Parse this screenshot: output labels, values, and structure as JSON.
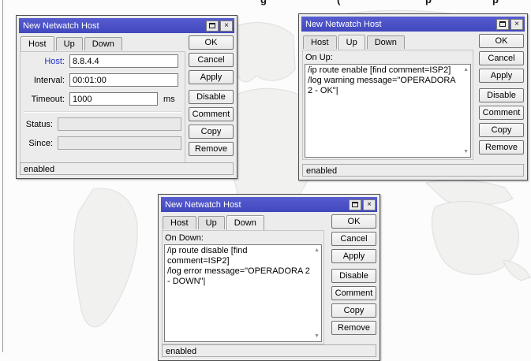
{
  "window": {
    "title": "New Netwatch Host",
    "close_glyph": "×"
  },
  "tabs": {
    "host": "Host",
    "up": "Up",
    "down": "Down"
  },
  "actions": {
    "ok": "OK",
    "cancel": "Cancel",
    "apply": "Apply",
    "disable": "Disable",
    "comment": "Comment",
    "copy": "Copy",
    "remove": "Remove"
  },
  "statusbar": {
    "text": "enabled"
  },
  "host_dialog": {
    "fields": {
      "host": {
        "label": "Host:",
        "value": "8.8.4.4"
      },
      "interval": {
        "label": "Interval:",
        "value": "00:01:00"
      },
      "timeout": {
        "label": "Timeout:",
        "value": "1000",
        "unit": "ms"
      },
      "status": {
        "label": "Status:",
        "value": ""
      },
      "since": {
        "label": "Since:",
        "value": ""
      }
    }
  },
  "up_dialog": {
    "script_label": "On Up:",
    "script_text": "/ip route enable [find comment=ISP2]\n/log warning message=\"OPERADORA 2 - OK\"|"
  },
  "down_dialog": {
    "script_label": "On Down:",
    "script_text": "/ip route disable [find comment=ISP2]\n/log error message=\"OPERADORA 2 - DOWN\"|"
  },
  "scrollbar": {
    "up_glyph": "▲",
    "down_glyph": "▼"
  },
  "background": {
    "cropped_text_fragments": [
      "g",
      "(",
      "p",
      "p"
    ]
  },
  "colors": {
    "titlebar_blue": "#4a50c6",
    "host_label_blue": "#2433c9"
  }
}
